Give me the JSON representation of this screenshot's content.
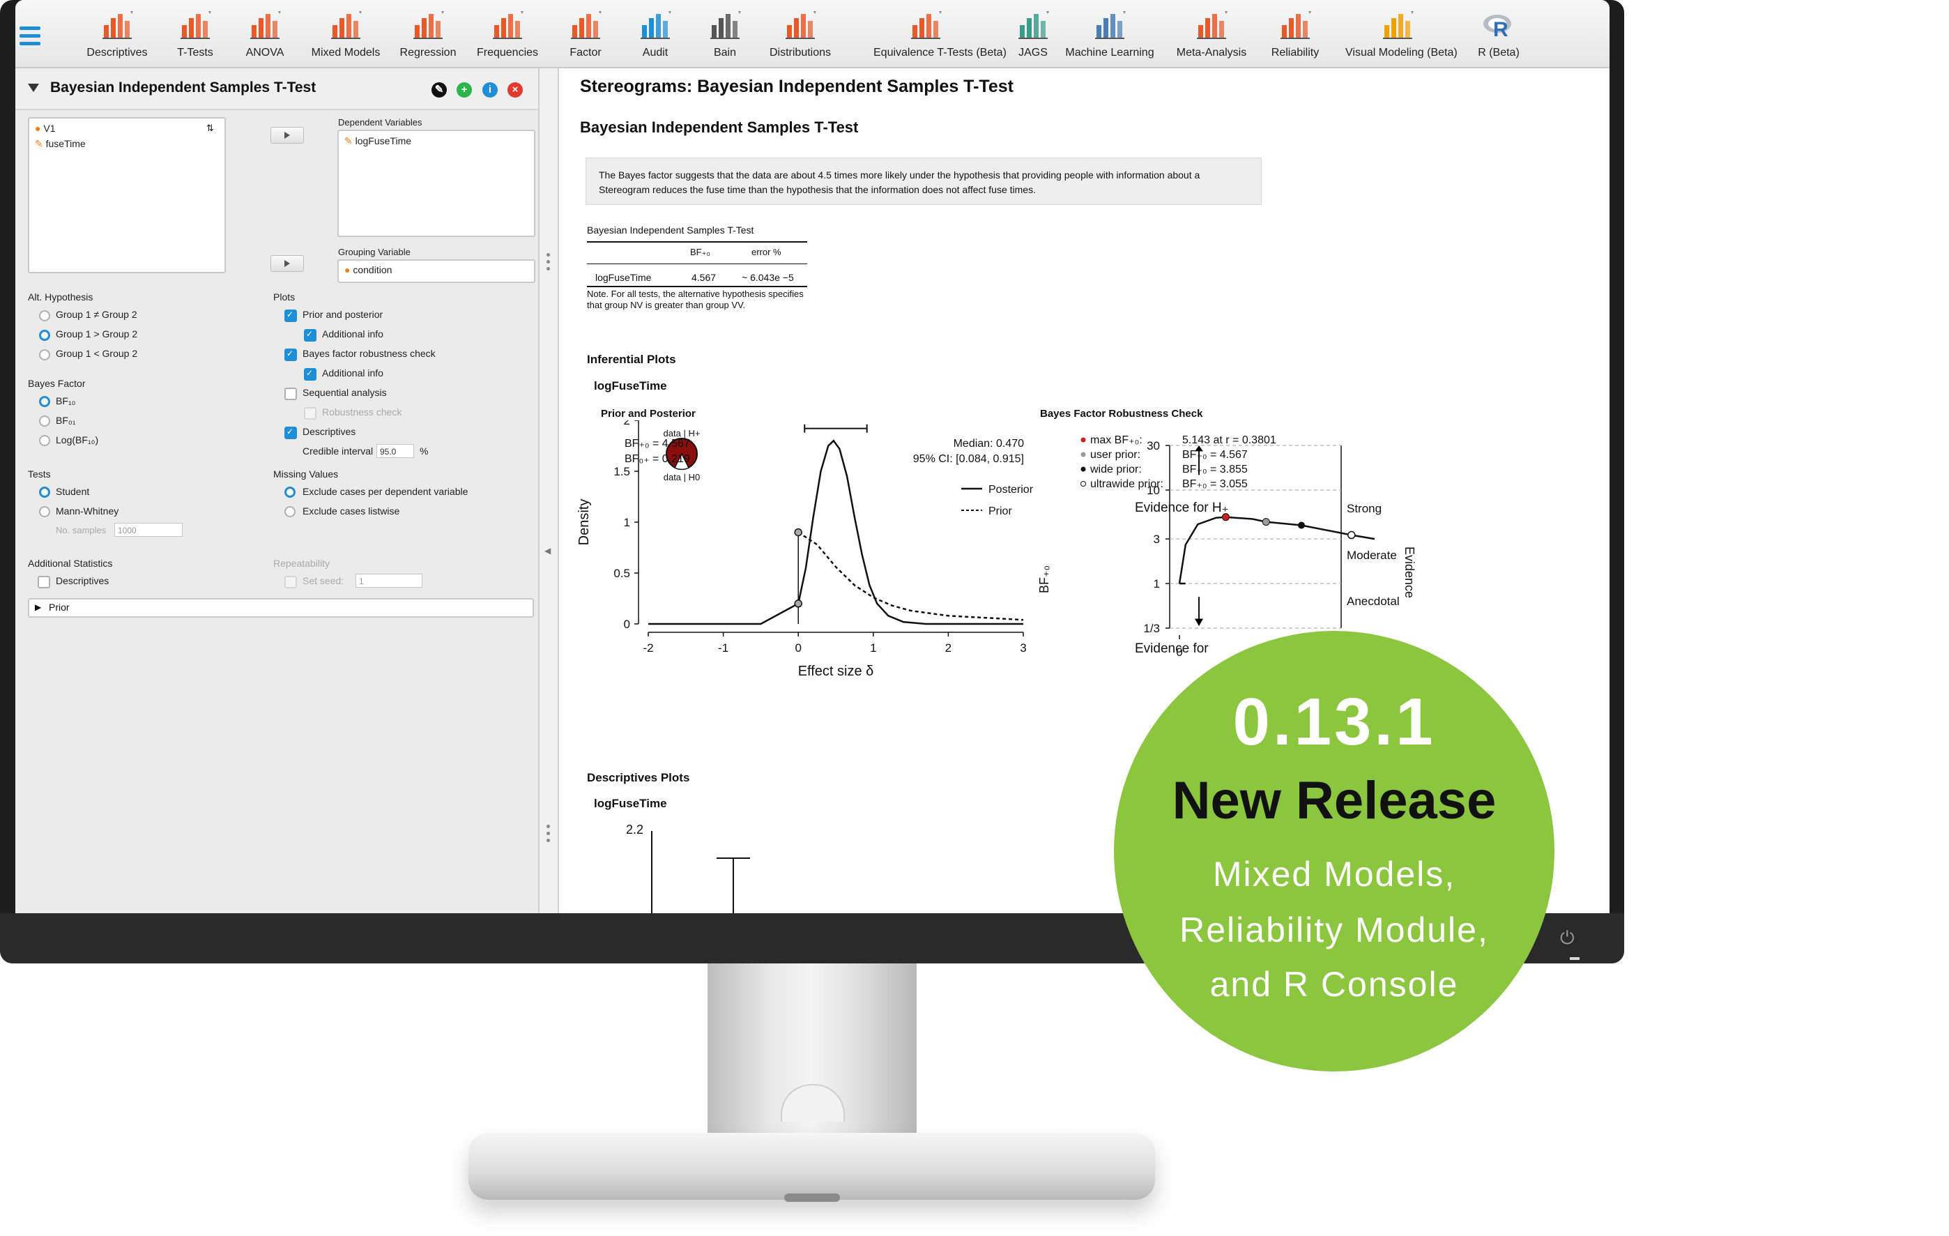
{
  "toolbar": {
    "items": [
      {
        "label": "Descriptives",
        "icon": "descriptives-icon"
      },
      {
        "label": "T-Tests",
        "icon": "t-tests-icon"
      },
      {
        "label": "ANOVA",
        "icon": "anova-icon"
      },
      {
        "label": "Mixed Models",
        "icon": "mixed-models-icon"
      },
      {
        "label": "Regression",
        "icon": "regression-icon"
      },
      {
        "label": "Frequencies",
        "icon": "frequencies-icon"
      },
      {
        "label": "Factor",
        "icon": "factor-icon"
      },
      {
        "label": "Audit",
        "icon": "audit-icon"
      },
      {
        "label": "Bain",
        "icon": "bain-icon"
      },
      {
        "label": "Distributions",
        "icon": "distributions-icon"
      },
      {
        "label": "Equivalence T-Tests (Beta)",
        "icon": "equivalence-icon"
      },
      {
        "label": "JAGS",
        "icon": "jags-icon"
      },
      {
        "label": "Machine Learning",
        "icon": "machine-learning-icon"
      },
      {
        "label": "Meta-Analysis",
        "icon": "meta-analysis-icon"
      },
      {
        "label": "Reliability",
        "icon": "reliability-icon"
      },
      {
        "label": "Visual Modeling (Beta)",
        "icon": "visual-modeling-icon"
      },
      {
        "label": "R (Beta)",
        "icon": "r-icon"
      }
    ]
  },
  "analysis": {
    "title": "Bayesian Independent Samples T-Test",
    "variables": [
      "V1",
      "fuseTime"
    ],
    "dependent_label": "Dependent Variables",
    "dependent_value": "logFuseTime",
    "grouping_label": "Grouping Variable",
    "grouping_value": "condition",
    "alt_hypothesis": {
      "label": "Alt. Hypothesis",
      "options": [
        "Group 1 ≠ Group 2",
        "Group 1 > Group 2",
        "Group 1 < Group 2"
      ],
      "selected": 1
    },
    "plots": {
      "label": "Plots",
      "prior_posterior": "Prior and posterior",
      "additional_info_1": "Additional info",
      "robustness": "Bayes factor robustness check",
      "additional_info_2": "Additional info",
      "sequential": "Sequential analysis",
      "robustness_check": "Robustness check",
      "descriptives": "Descriptives",
      "credible_interval_label": "Credible interval",
      "credible_interval_value": "95.0",
      "credible_interval_unit": "%"
    },
    "bayes_factor": {
      "label": "Bayes Factor",
      "options": [
        "BF₁₀",
        "BF₀₁",
        "Log(BF₁₀)"
      ],
      "selected": 0
    },
    "tests": {
      "label": "Tests",
      "options": [
        "Student",
        "Mann-Whitney"
      ],
      "selected": 0,
      "no_samples_label": "No. samples",
      "no_samples_placeholder": "1000"
    },
    "missing": {
      "label": "Missing Values",
      "options": [
        "Exclude cases per dependent variable",
        "Exclude cases listwise"
      ],
      "selected": 0
    },
    "additional_stats": {
      "label": "Additional Statistics",
      "descriptives": "Descriptives"
    },
    "repeatability": {
      "label": "Repeatability",
      "set_seed": "Set seed:",
      "seed_value": "1"
    },
    "prior_section": "Prior"
  },
  "output": {
    "title": "Stereograms: Bayesian Independent Samples T-Test",
    "subtitle": "Bayesian Independent Samples T-Test",
    "note": "The Bayes factor suggests that the data are about 4.5 times more likely under the hypothesis that providing people with information about a Stereogram reduces the fuse time than the hypothesis that the information does not affect fuse times.",
    "table": {
      "caption": "Bayesian Independent Samples T-Test",
      "col_bf": "BF₊₀",
      "col_error": "error %",
      "row_label": "logFuseTime",
      "row_bf": "4.567",
      "row_error": "~ 6.043e −5",
      "footnote": "Note. For all tests, the alternative hypothesis specifies that group NV is greater than group VV."
    },
    "inferential_heading": "Inferential Plots",
    "inferential_var": "logFuseTime",
    "descriptives_heading": "Descriptives Plots",
    "descriptives_var": "logFuseTime",
    "descriptives_ytick": "2.2"
  },
  "prior_posterior_plot": {
    "title": "Prior and Posterior",
    "bf_plus0": "BF₊₀ = 4.567",
    "bf_0plus": "BF₀₊ = 0.219",
    "median": "Median: 0.470",
    "ci": "95% CI: [0.084, 0.915]",
    "pie_top": "data | H+",
    "pie_bottom": "data | H0",
    "legend_posterior": "Posterior",
    "legend_prior": "Prior"
  },
  "robustness_plot": {
    "title": "Bayes Factor Robustness Check",
    "legend": [
      {
        "label": "max BF₊₀:",
        "value": "5.143 at r = 0.3801"
      },
      {
        "label": "user prior:",
        "value": "BF₊₀ = 4.567"
      },
      {
        "label": "wide prior:",
        "value": "BF₊₀ = 3.855"
      },
      {
        "label": "ultrawide prior:",
        "value": "BF₊₀ = 3.055"
      }
    ],
    "evidence_h1": "Evidence for H₊",
    "evidence_h0": "Evidence for",
    "strong": "Strong",
    "moderate": "Moderate",
    "anecdotal": "Anecdotal",
    "evidence_axis": "Evidence",
    "yaxis": "BF₊₀"
  },
  "chart_data": [
    {
      "type": "line",
      "title": "Prior and Posterior",
      "xlabel": "Effect size δ",
      "ylabel": "Density",
      "xlim": [
        -2,
        3
      ],
      "ylim": [
        0,
        2
      ],
      "xticks": [
        "-2",
        "-1",
        "0",
        "1",
        "2",
        "3"
      ],
      "yticks": [
        "0",
        "0.5",
        "1",
        "1.5",
        "2"
      ],
      "series": [
        {
          "name": "Posterior",
          "x": [
            -2,
            -1,
            -0.5,
            0,
            0.1,
            0.2,
            0.3,
            0.4,
            0.47,
            0.55,
            0.65,
            0.75,
            0.85,
            0.95,
            1.05,
            1.2,
            1.4,
            1.7,
            2.0,
            3.0
          ],
          "y": [
            0,
            0,
            0,
            0.2,
            0.55,
            1.05,
            1.5,
            1.75,
            1.8,
            1.72,
            1.45,
            1.05,
            0.68,
            0.38,
            0.2,
            0.08,
            0.02,
            0,
            0,
            0
          ]
        },
        {
          "name": "Prior",
          "x": [
            0,
            0.25,
            0.5,
            0.75,
            1.0,
            1.25,
            1.5,
            2.0,
            2.5,
            3.0
          ],
          "y": [
            0.9,
            0.78,
            0.56,
            0.38,
            0.26,
            0.18,
            0.13,
            0.08,
            0.06,
            0.04
          ]
        }
      ]
    },
    {
      "type": "line",
      "title": "Bayes Factor Robustness Check",
      "ylabel": "BF₊₀",
      "ylim": [
        0.333,
        30
      ],
      "yticks": [
        "1/3",
        "1",
        "3",
        "10",
        "30"
      ],
      "xticks": [
        "0"
      ],
      "series": [
        {
          "name": "BF₊₀",
          "x": [
            0,
            0.05,
            0.15,
            0.3,
            0.38,
            0.6,
            0.71,
            1.0,
            1.41,
            1.6
          ],
          "y": [
            1,
            2.6,
            4.3,
            5.05,
            5.143,
            4.9,
            4.567,
            4.2,
            3.3,
            3.0
          ]
        }
      ]
    }
  ],
  "badge": {
    "version": "0.13.1",
    "headline": "New Release",
    "line1": "Mixed Models,",
    "line2": "Reliability Module,",
    "line3": "and R Console",
    "color": "#8cc63f"
  },
  "colors": {
    "accent": "#1e8fd6",
    "orange": "#f07f1a",
    "max_point": "#cc1f1f"
  }
}
